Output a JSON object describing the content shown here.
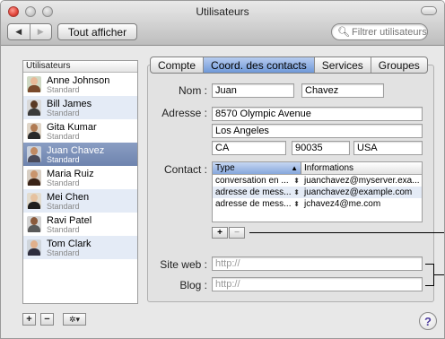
{
  "window": {
    "title": "Utilisateurs"
  },
  "toolbar": {
    "back": "◀",
    "forward": "▶",
    "show_all": "Tout afficher",
    "search_placeholder": "Filtrer utilisateurs"
  },
  "users": {
    "header": "Utilisateurs",
    "items": [
      {
        "name": "Anne Johnson",
        "role": "Standard"
      },
      {
        "name": "Bill James",
        "role": "Standard"
      },
      {
        "name": "Gita Kumar",
        "role": "Standard"
      },
      {
        "name": "Juan Chavez",
        "role": "Standard"
      },
      {
        "name": "Maria Ruiz",
        "role": "Standard"
      },
      {
        "name": "Mei Chen",
        "role": "Standard"
      },
      {
        "name": "Ravi Patel",
        "role": "Standard"
      },
      {
        "name": "Tom Clark",
        "role": "Standard"
      }
    ],
    "selected_index": 3
  },
  "bottom": {
    "add": "+",
    "remove": "−",
    "action": "✲▾",
    "help": "?"
  },
  "tabs": [
    {
      "label": "Compte"
    },
    {
      "label": "Coord. des contacts"
    },
    {
      "label": "Services"
    },
    {
      "label": "Groupes"
    }
  ],
  "form": {
    "nom_label": "Nom :",
    "first_name": "Juan",
    "last_name": "Chavez",
    "adresse_label": "Adresse :",
    "street": "8570 Olympic Avenue",
    "city": "Los Angeles",
    "state": "CA",
    "zip": "90035",
    "country": "USA",
    "contact_label": "Contact :",
    "contact_table": {
      "col_type": "Type",
      "col_info": "Informations",
      "sort_arrow": "▲",
      "rows": [
        {
          "type": "conversation en ...",
          "info": "juanchavez@myserver.exa..."
        },
        {
          "type": "adresse de mess...",
          "info": "juanchavez@example.com"
        },
        {
          "type": "adresse de mess...",
          "info": "jchavez4@me.com"
        }
      ]
    },
    "contact_add": "+",
    "contact_remove": "−",
    "site_label": "Site web :",
    "site_placeholder": "http://",
    "blog_label": "Blog :",
    "blog_placeholder": "http://"
  }
}
